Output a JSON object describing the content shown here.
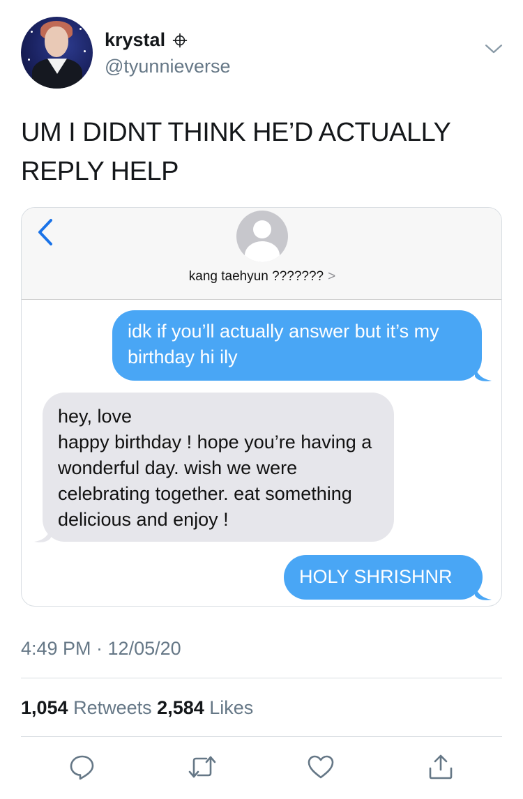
{
  "tweet": {
    "user": {
      "display_name": "krystal",
      "handle": "@tyunnieverse"
    },
    "text": "UM I DIDNT THINK HE’D ACTUALLY REPLY HELP",
    "timestamp": "4:49 PM · 12/05/20",
    "stats": {
      "retweets_count": "1,054",
      "retweets_label": "Retweets",
      "likes_count": "2,584",
      "likes_label": "Likes"
    }
  },
  "imessage": {
    "contact_name": "kang taehyun ???????",
    "contact_arrow": ">",
    "messages": [
      {
        "direction": "sent",
        "text": "idk if you’ll actually answer but it’s my birthday hi ily"
      },
      {
        "direction": "received",
        "lines": [
          "hey, love",
          "happy birthday ! hope you’re having a wonderful day. wish we were celebrating together. eat something delicious and enjoy !"
        ]
      },
      {
        "direction": "sent",
        "text": "HOLY SHRISHNR"
      }
    ]
  },
  "colors": {
    "sent_bubble": "#49a6f5",
    "received_bubble": "#e6e6eb",
    "ios_blue": "#1a73e8",
    "twitter_gray": "#657786"
  },
  "icons": [
    "chevron-down-icon",
    "back-chevron-icon",
    "reply-icon",
    "retweet-icon",
    "like-icon",
    "share-icon"
  ]
}
